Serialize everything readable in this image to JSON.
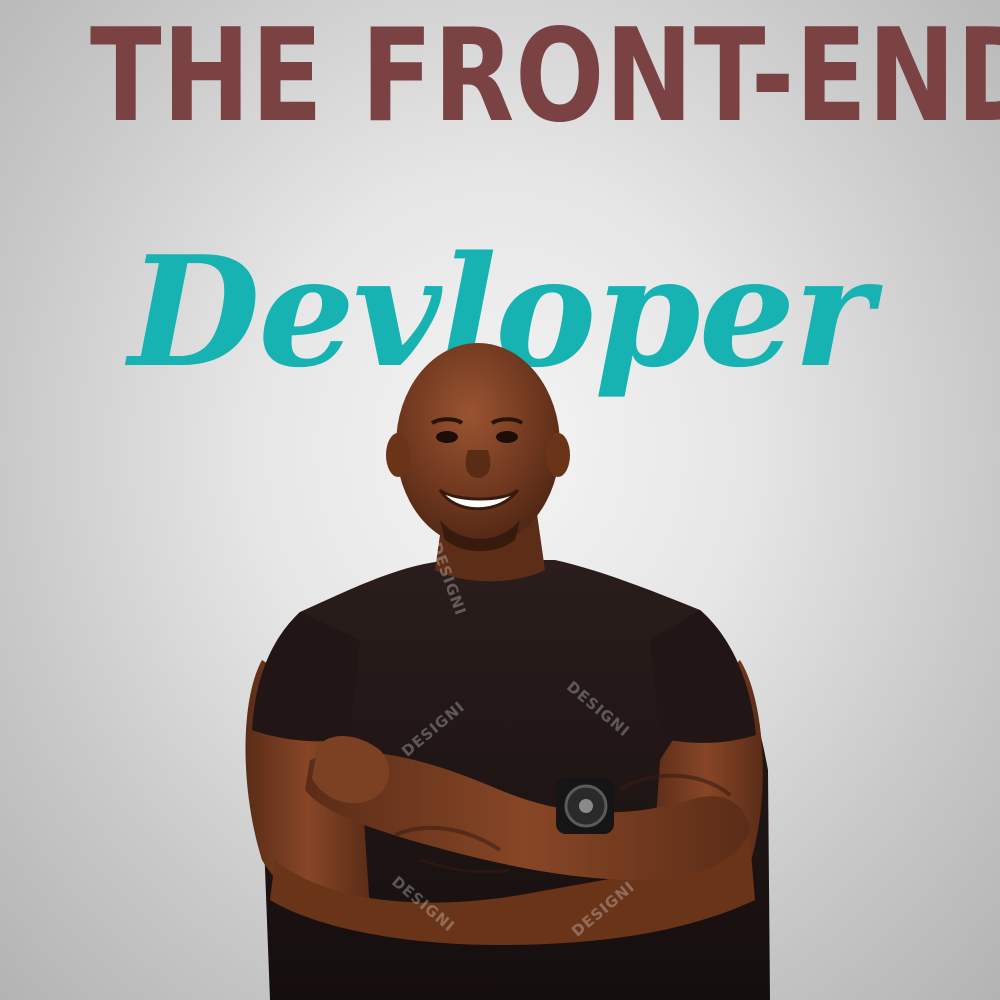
{
  "poster": {
    "headline": "THE FRONT-END",
    "script_title": "Devloper",
    "watermark": "DESIGNI"
  },
  "colors": {
    "headline": "#7a4243",
    "script_title": "#17b2b2",
    "background": "#e6e6e6",
    "shirt": "#1c1313",
    "skin": "#7a3e22"
  },
  "photo": {
    "subject": "smiling man in black t-shirt with crossed arms and wristwatch"
  }
}
